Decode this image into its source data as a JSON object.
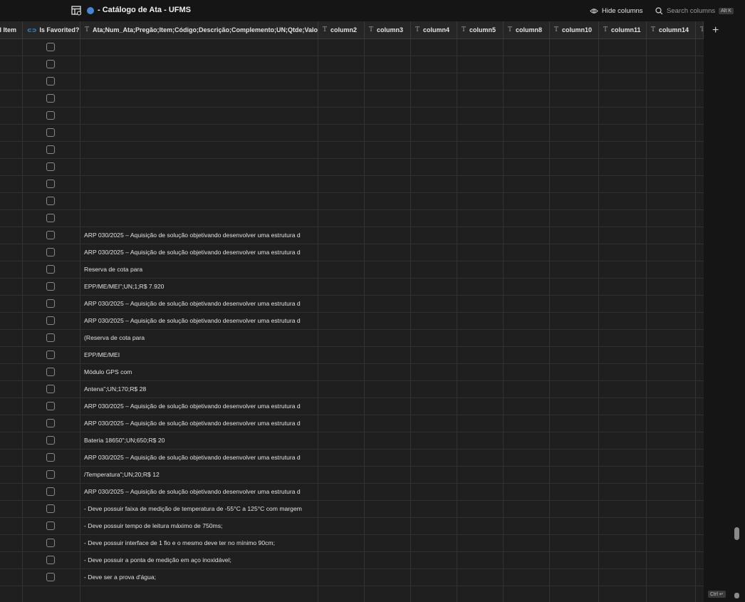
{
  "app": {
    "title": "- Catálogo de Ata - UFMS",
    "hide_columns_label": "Hide columns",
    "search_placeholder": "Search columns",
    "search_shortcut": "Alt K",
    "ctrl_badge": "Ctrl ↵",
    "accent_color": "#4b82d6"
  },
  "columns": [
    {
      "label": "l Item",
      "type": "none"
    },
    {
      "label": "Is Favorited?",
      "type": "favorite"
    },
    {
      "label": "Ata;Num_Ata;Pregão;Item;Código;Descrição;Complemento;UN;Qtde;Valor",
      "type": "text"
    },
    {
      "label": "column2",
      "type": "text"
    },
    {
      "label": "column3",
      "type": "text"
    },
    {
      "label": "column4",
      "type": "text"
    },
    {
      "label": "column5",
      "type": "text"
    },
    {
      "label": "column8",
      "type": "text"
    },
    {
      "label": "column10",
      "type": "text"
    },
    {
      "label": "column11",
      "type": "text"
    },
    {
      "label": "column14",
      "type": "text"
    },
    {
      "label": "T",
      "type": "text"
    }
  ],
  "rows": [
    "",
    "",
    "",
    "",
    "",
    "",
    "",
    "",
    "",
    "",
    "",
    "ARP 030/2025 – Aquisição de solução objetivando desenvolver uma estrutura d",
    "ARP 030/2025 – Aquisição de solução objetivando desenvolver uma estrutura d",
    "Reserva de cota para",
    "EPP/ME/MEI\";UN;1;R$ 7.920",
    "ARP 030/2025 – Aquisição de solução objetivando desenvolver uma estrutura d",
    "ARP 030/2025 – Aquisição de solução objetivando desenvolver uma estrutura d",
    "(Reserva de cota para",
    "EPP/ME/MEI",
    "Módulo GPS com",
    "Antena\";UN;170;R$ 28",
    "ARP 030/2025 – Aquisição de solução objetivando desenvolver uma estrutura d",
    "ARP 030/2025 – Aquisição de solução objetivando desenvolver uma estrutura d",
    "Bateria 18650\";UN;650;R$ 20",
    "ARP 030/2025 – Aquisição de solução objetivando desenvolver uma estrutura d",
    "/Temperatura\";UN;20;R$ 12",
    "ARP 030/2025 – Aquisição de solução objetivando desenvolver uma estrutura d",
    "- Deve possuir faixa de medição de temperatura de -55°C a 125°C com margem",
    "- Deve possuir tempo de leitura máximo de 750ms;",
    "- Deve possuir interface de 1 fio e o mesmo deve ter no mínimo 90cm;",
    "- Deve possuir a ponta de medição em aço inoxidável;",
    "- Deve ser a prova d'água;"
  ]
}
